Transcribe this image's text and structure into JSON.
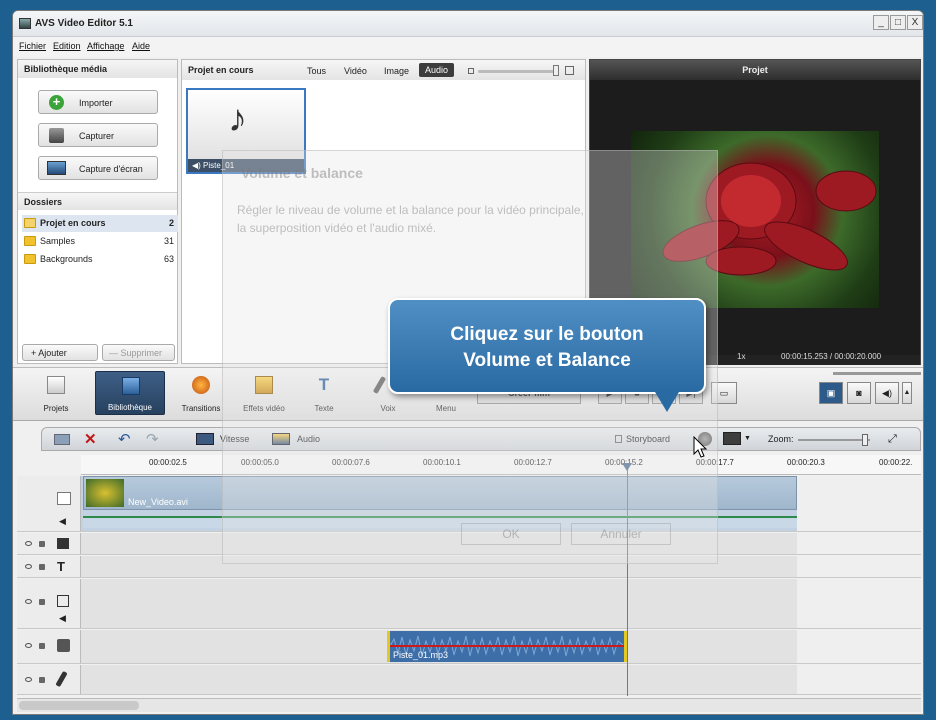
{
  "window": {
    "title": "AVS Video Editor 5.1",
    "controls": [
      "_",
      "□",
      "X"
    ]
  },
  "menu": [
    "Fichier",
    "Edition",
    "Affichage",
    "Aide"
  ],
  "library": {
    "title": "Bibliothèque média",
    "buttons": [
      "Importer",
      "Capturer",
      "Capture d'écran"
    ],
    "folders_title": "Dossiers",
    "folders": [
      {
        "name": "Projet en cours",
        "count": "2"
      },
      {
        "name": "Samples",
        "count": "31"
      },
      {
        "name": "Backgrounds",
        "count": "63"
      }
    ],
    "add_label": "+ Ajouter",
    "remove_label": "— Supprimer"
  },
  "project": {
    "title": "Projet en cours",
    "filters": [
      "Tous",
      "Vidéo",
      "Image",
      "Audio"
    ],
    "active_filter": "Audio",
    "item_label": "Piste_01"
  },
  "preview": {
    "title": "Projet",
    "speed": "1x",
    "time": "00:00:15.253 / 00:00:20.000"
  },
  "toolbar": {
    "buttons": [
      "Projets",
      "Bibliothèque",
      "Transitions",
      "Effets vidéo",
      "Texte",
      "Voix",
      "Menu"
    ],
    "active": "Bibliothèque",
    "create_label": "Créer film"
  },
  "timeline_toolbar": {
    "speed_label": "Vitesse",
    "audio_label": "Audio",
    "storyboard_label": "Storyboard",
    "zoom_label": "Zoom:"
  },
  "ruler": [
    "00:00:02.5",
    "00:00:05.0",
    "00:00:07.6",
    "00:00:10.1",
    "00:00:12.7",
    "00:00:15.2",
    "00:00:17.7",
    "00:00:20.3",
    "00:00:22."
  ],
  "clips": {
    "video": "New_Video.avi",
    "audio": "Piste_01.mp3"
  },
  "tooltip": {
    "line1": "Cliquez sur le bouton",
    "line2": "Volume et Balance"
  },
  "ghost_dialog": {
    "title": "Volume et balance",
    "text1": "Régler le niveau de volume et la balance pour la vidéo principale,",
    "text2": "la superposition vidéo et l'audio mixé.",
    "ok": "OK",
    "cancel": "Annuler"
  },
  "colors": {
    "accent": "#2a6aa3",
    "active_tab": "#27415f",
    "audio_clip": "#3d6ea8",
    "waveform": "#cc1a1a"
  }
}
